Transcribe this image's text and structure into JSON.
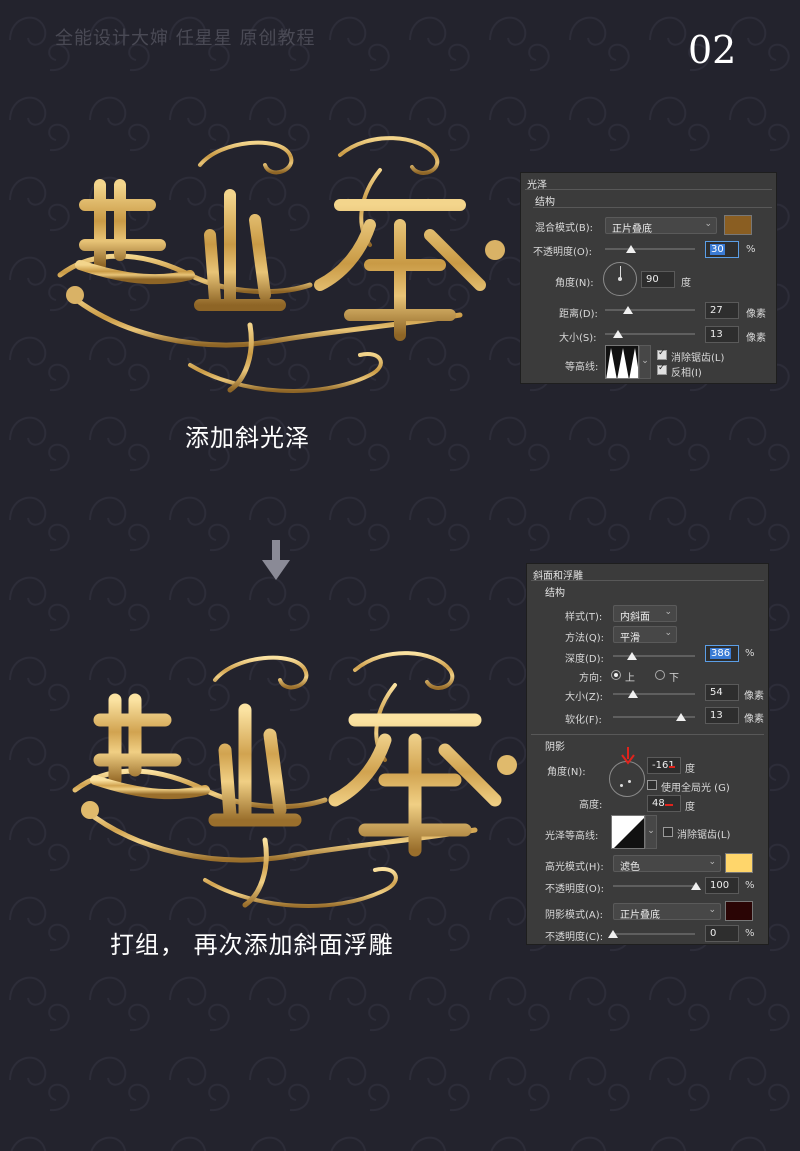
{
  "watermark": "全能设计大婶  任星星   原创教程",
  "page_number": "02",
  "captions": {
    "step1": "添加斜光泽",
    "step2": "打组， 再次添加斜面浮雕"
  },
  "colors": {
    "background": "#23232d",
    "gold": "#d2a85a",
    "satin_swatch": "#8a5e22",
    "highlight_swatch": "#ffd66b",
    "shadow_swatch": "#2a0505"
  },
  "satin_panel": {
    "title": "光泽",
    "section": "结构",
    "blend_mode_label": "混合模式(B):",
    "blend_mode_value": "正片叠底",
    "opacity_label": "不透明度(O):",
    "opacity_value": "30",
    "opacity_unit": "%",
    "opacity_level": 0.3,
    "angle_label": "角度(N):",
    "angle_value": "90",
    "angle_unit": "度",
    "distance_label": "距离(D):",
    "distance_value": "27",
    "distance_unit": "像素",
    "size_label": "大小(S):",
    "size_value": "13",
    "size_unit": "像素",
    "contour_label": "等高线:",
    "antialias_label": "消除锯齿(L)",
    "antialias_checked": true,
    "invert_label": "反相(I)",
    "invert_checked": true
  },
  "bevel_panel": {
    "title": "斜面和浮雕",
    "section": "结构",
    "style_label": "样式(T):",
    "style_value": "内斜面",
    "technique_label": "方法(Q):",
    "technique_value": "平滑",
    "depth_label": "深度(D):",
    "depth_value": "386",
    "depth_unit": "%",
    "direction_label": "方向:",
    "direction_up": "上",
    "direction_down": "下",
    "direction_selected": "上",
    "size_label": "大小(Z):",
    "size_value": "54",
    "size_unit": "像素",
    "soften_label": "软化(F):",
    "soften_value": "13",
    "soften_unit": "像素",
    "shading_section": "阴影",
    "angle_label": "角度(N):",
    "angle_value": "-161",
    "angle_unit": "度",
    "global_light_label": "使用全局光 (G)",
    "global_light_checked": false,
    "altitude_label": "高度:",
    "altitude_value": "48",
    "altitude_unit": "度",
    "gloss_contour_label": "光泽等高线:",
    "antialias_label": "消除锯齿(L)",
    "antialias_checked": false,
    "highlight_mode_label": "高光模式(H):",
    "highlight_mode_value": "滤色",
    "highlight_opacity_label": "不透明度(O):",
    "highlight_opacity_value": "100",
    "highlight_opacity_unit": "%",
    "shadow_mode_label": "阴影模式(A):",
    "shadow_mode_value": "正片叠底",
    "shadow_opacity_label": "不透明度(C):",
    "shadow_opacity_value": "0",
    "shadow_opacity_unit": "%"
  }
}
